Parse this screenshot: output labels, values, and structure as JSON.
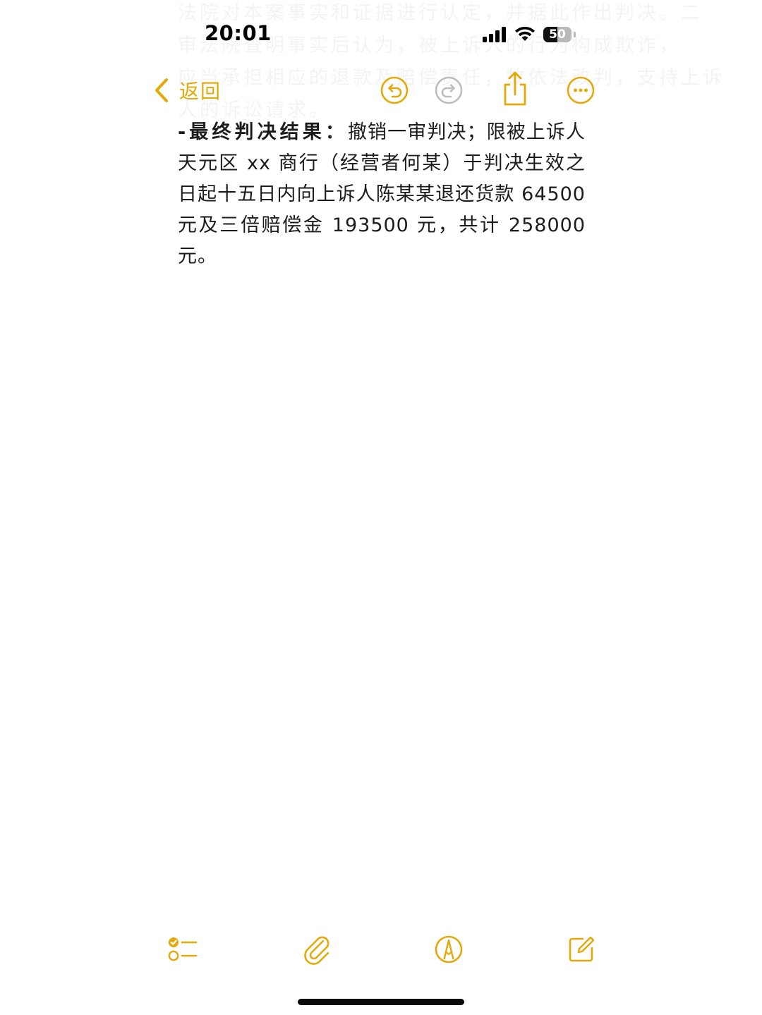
{
  "status_bar": {
    "time": "20:01",
    "battery_percent": "50",
    "battery_level": 0.5
  },
  "ghost_lines": [
    "法院对本案事实和证据进行认定，并据此作出判决。二",
    "审法院查明事实后认为，被上诉人的行为构成欺诈，",
    "应当承担相应的退款及赔偿责任，故依法改判，支持上诉",
    "人的诉讼请求。"
  ],
  "nav": {
    "back_label": "返回"
  },
  "note": {
    "bold_prefix": "-最终判决结果：",
    "body_text": "撤销一审判决；限被上诉人天元区 xx 商行（经营者何某）于判决生效之日起十五日内向上诉人陈某某退还货款 64500 元及三倍赔偿金 193500 元，共计 258000 元。"
  },
  "icons": {
    "back": "chevron-left-icon",
    "undo": "undo-icon",
    "redo": "redo-icon",
    "share": "share-icon",
    "more": "more-icon",
    "checklist": "checklist-icon",
    "attach": "paperclip-icon",
    "markup": "markup-pen-icon",
    "compose": "compose-icon"
  },
  "colors": {
    "accent": "#E3A90A",
    "disabled": "#BDBDBD",
    "text": "#1C1C1C"
  }
}
